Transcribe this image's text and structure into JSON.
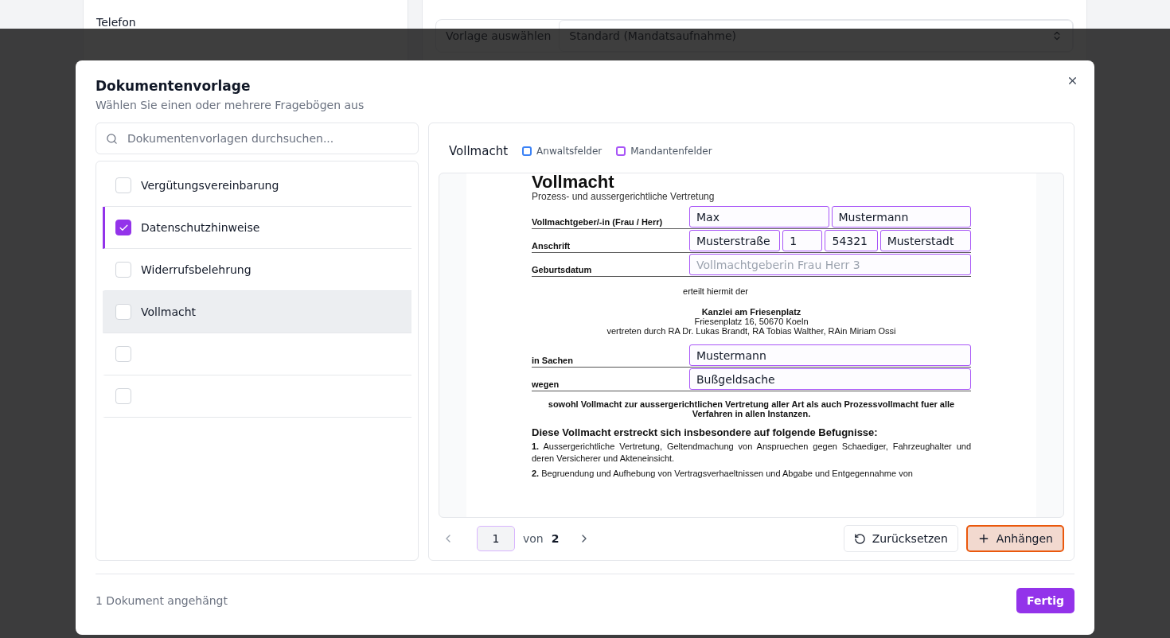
{
  "background": {
    "phone_label": "Telefon",
    "template_label": "Vorlage auswählen",
    "template_value": "Standard (Mandatsaufnahme)"
  },
  "dialog": {
    "title": "Dokumentenvorlage",
    "subtitle": "Wählen Sie einen oder mehrere Fragebögen aus",
    "search": {
      "placeholder": "Dokumentenvorlagen durchsuchen..."
    },
    "templates": [
      {
        "label": "Vergütungsvereinbarung",
        "checked": false,
        "selected": false
      },
      {
        "label": "Datenschutzhinweise",
        "checked": true,
        "selected": false
      },
      {
        "label": "Widerrufsbelehrung",
        "checked": false,
        "selected": false
      },
      {
        "label": "Vollmacht",
        "checked": false,
        "selected": true
      },
      {
        "checked": false,
        "selected": false
      },
      {
        "checked": false,
        "selected": false
      }
    ],
    "preview": {
      "title": "Vollmacht",
      "legend": [
        {
          "label": "Anwaltsfelder",
          "color": "#3b82f6"
        },
        {
          "label": "Mandantenfelder",
          "color": "#a855f7"
        }
      ],
      "document": {
        "heading": "Vollmacht",
        "subheading": "Prozess- und aussergerichtliche Vertretung",
        "rows": [
          {
            "label": "Vollmachtgeber/-in (Frau / Herr)",
            "fields": [
              {
                "value": "Max",
                "color": "#a855f7"
              },
              {
                "value": "Mustermann",
                "color": "#a855f7"
              }
            ]
          },
          {
            "label": "Anschrift",
            "fields": [
              {
                "value": "Musterstraße",
                "color": "#a855f7"
              },
              {
                "value": "1",
                "color": "#a855f7"
              },
              {
                "value": "54321",
                "color": "#a855f7"
              },
              {
                "value": "Musterstadt",
                "color": "#a855f7"
              }
            ]
          },
          {
            "label": "Geburtsdatum",
            "fields": [
              {
                "placeholder": "Vollmachtgeberin Frau Herr 3",
                "color": "#a855f7"
              }
            ]
          }
        ],
        "grant": "erteilt hiermit der",
        "firm_name": "Kanzlei am Friesenplatz",
        "firm_address": "Friesenplatz 16, 50670 Koeln",
        "firm_lawyers": "vertreten durch RA Dr. Lukas Brandt, RA Tobias Walther, RAin Miriam Ossi",
        "case_rows": [
          {
            "label": "in Sachen",
            "fields": [
              {
                "value": "Mustermann",
                "color": "#a855f7"
              }
            ]
          },
          {
            "label": "wegen",
            "fields": [
              {
                "value": "Bußgeldsache",
                "color": "#a855f7"
              }
            ]
          }
        ],
        "scope": "sowohl Vollmacht zur aussergerichtlichen Vertretung aller Art als auch Prozessvollmacht fuer alle Verfahren in allen Instanzen.",
        "powers_heading": "Diese Vollmacht erstreckt sich insbesondere auf folgende Befugnisse:",
        "powers": [
          "**1.** Aussergerichtliche Vertretung, Geltendmachung von Anspruechen gegen Schaediger, Fahrzeughalter und deren Versicherer und Akteneinsicht.",
          "**2.** Begruendung und Aufhebung von Vertragsverhaeltnissen und Abgabe und Entgegennahme von"
        ]
      },
      "pagination": {
        "page": "1",
        "of": "von",
        "total": "2"
      },
      "reset_button": "Zurücksetzen",
      "attach_button": "Anhängen"
    },
    "status": "1 Dokument angehängt",
    "done_button": "Fertig"
  }
}
